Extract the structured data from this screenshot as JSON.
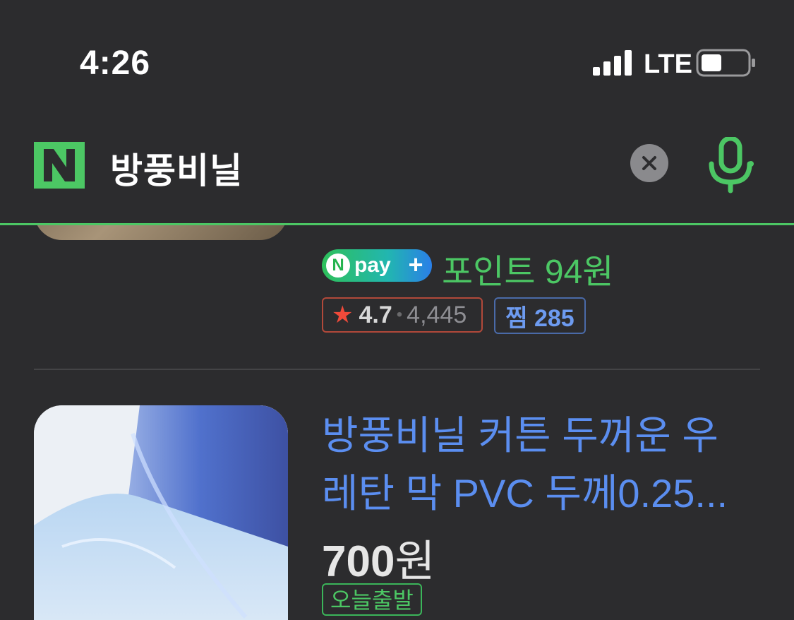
{
  "status": {
    "time": "4:26",
    "network": "LTE"
  },
  "search": {
    "logo": "N",
    "query": "방풍비닐"
  },
  "prev_item": {
    "npay_label": "pay",
    "points": "포인트 94원",
    "rating": "4.7",
    "review_count": "4,445",
    "zzim": "찜 285"
  },
  "item": {
    "title_line1": "방풍비닐 커튼 두꺼운 우",
    "title_line2": "레탄 막 PVC 두께0.25...",
    "price_number": "700",
    "price_unit": "원",
    "badge": "오늘출발"
  },
  "icons": {
    "signal": "signal-icon",
    "battery": "battery-icon",
    "clear": "close-icon",
    "mic": "microphone-icon",
    "star": "star-icon"
  },
  "colors": {
    "accent": "#4cc764",
    "link": "#5b8ef0",
    "background": "#2c2c2e"
  }
}
